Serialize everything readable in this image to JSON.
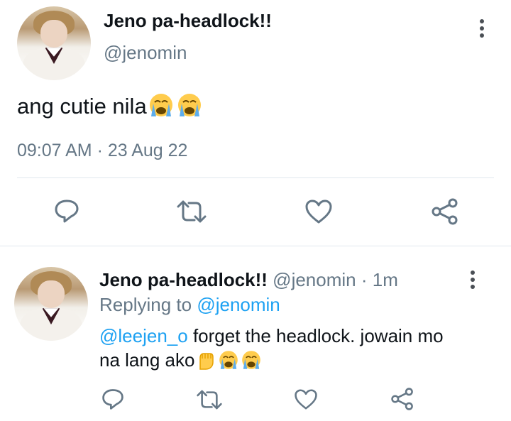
{
  "tweet": {
    "author_name": "Jeno pa-headlock!!",
    "handle": "@jenomin",
    "text": "ang cutie nila",
    "timestamp": "09:07 AM · 23 Aug 22"
  },
  "reply": {
    "author_name": "Jeno pa-headlock!!",
    "handle": "@jenomin",
    "time": "· 1m",
    "replying_prefix": "Replying to",
    "replying_to": "@jenomin",
    "mention": "@leejen_o",
    "line1": "forget the headlock. jowain mo",
    "line2": "na lang ako"
  },
  "icons": {
    "actions": [
      "reply-icon",
      "retweet-icon",
      "like-icon",
      "share-icon"
    ],
    "menu": "more-options-icon",
    "emoji_cry": "loudly-crying-face",
    "emoji_fist": "raised-fist"
  },
  "colors": {
    "text": "#0f1419",
    "muted": "#657786",
    "link": "#1da1f2",
    "icon": "#657786",
    "divider": "#e1e8ed"
  }
}
